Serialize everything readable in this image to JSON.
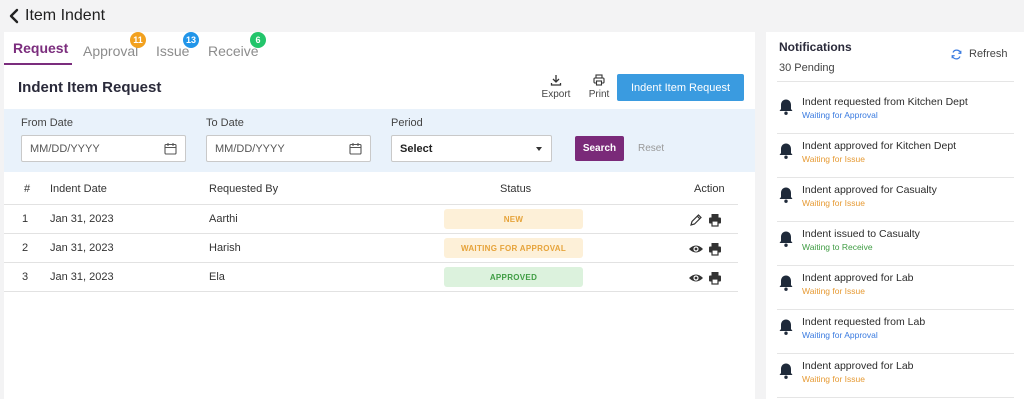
{
  "header": {
    "back_icon": "chevron-left-icon",
    "title": "Item Indent"
  },
  "tabs": [
    {
      "label": "Request",
      "active": true
    },
    {
      "label": "Approval",
      "badge": "11",
      "badge_color": "#f2a11f"
    },
    {
      "label": "Issue",
      "badge": "13",
      "badge_color": "#2195e9"
    },
    {
      "label": "Receive",
      "badge": "6",
      "badge_color": "#23c56b"
    }
  ],
  "section": {
    "title": "Indent Item Request",
    "export_label": "Export",
    "print_label": "Print",
    "primary_button": "Indent Item Request"
  },
  "filters": {
    "from_label": "From Date",
    "from_placeholder": "MM/DD/YYYY",
    "to_label": "To Date",
    "to_placeholder": "MM/DD/YYYY",
    "period_label": "Period",
    "period_value": "Select",
    "search_label": "Search",
    "reset_label": "Reset"
  },
  "table": {
    "headers": {
      "num": "#",
      "date": "Indent Date",
      "by": "Requested By",
      "status": "Status",
      "action": "Action"
    },
    "rows": [
      {
        "num": "1",
        "date": "Jan 31, 2023",
        "by": "Aarthi",
        "status": "NEW",
        "status_bg": "#fdf0d8",
        "status_color": "#e6a33a",
        "actions": [
          "edit-icon",
          "print-icon"
        ]
      },
      {
        "num": "2",
        "date": "Jan 31, 2023",
        "by": "Harish",
        "status": "WAITING FOR APPROVAL",
        "status_bg": "#fdf0d8",
        "status_color": "#e6a33a",
        "actions": [
          "view-icon",
          "print-icon"
        ]
      },
      {
        "num": "3",
        "date": "Jan 31, 2023",
        "by": "Ela",
        "status": "APPROVED",
        "status_bg": "#dcf2dd",
        "status_color": "#3f9c43",
        "actions": [
          "view-icon",
          "print-icon"
        ]
      }
    ]
  },
  "notifications": {
    "title": "Notifications",
    "count": "30 Pending",
    "refresh_label": "Refresh",
    "items": [
      {
        "text": "Indent requested from Kitchen Dept",
        "sub": "Waiting for Approval",
        "color": "#3a7be0"
      },
      {
        "text": "Indent approved for Kitchen Dept",
        "sub": "Waiting for Issue",
        "color": "#e69a33"
      },
      {
        "text": "Indent approved for Casualty",
        "sub": "Waiting for Issue",
        "color": "#e69a33"
      },
      {
        "text": "Indent issued to Casualty",
        "sub": "Waiting to Receive",
        "color": "#3f9c43"
      },
      {
        "text": "Indent approved for Lab",
        "sub": "Waiting for Issue",
        "color": "#e69a33"
      },
      {
        "text": "Indent requested from Lab",
        "sub": "Waiting for Approval",
        "color": "#3a7be0"
      },
      {
        "text": "Indent approved for Lab",
        "sub": "Waiting for Issue",
        "color": "#e69a33"
      }
    ]
  }
}
